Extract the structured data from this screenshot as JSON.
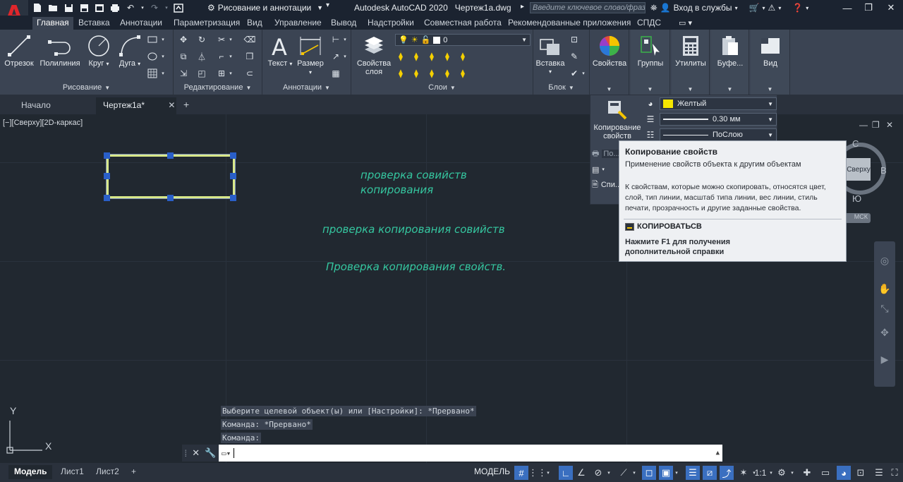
{
  "titlebar": {
    "logo": "A",
    "workspace": "Рисование и аннотации",
    "app_title": "Autodesk AutoCAD 2020",
    "file_name": "Чертеж1a.dwg",
    "search_placeholder": "Введите ключевое слово/фразу",
    "signin": "Вход в службы",
    "icons": [
      "new-icon",
      "open-icon",
      "save-icon",
      "saveas-icon",
      "web-icon",
      "print-icon",
      "undo-icon",
      "redo-icon",
      "share-icon",
      "gear-icon",
      "search-icon",
      "binoculars-icon",
      "user-icon",
      "cart-icon",
      "triangle-icon",
      "help-icon",
      "minimize-icon",
      "restore-icon",
      "close-icon"
    ]
  },
  "ribbon_tabs": [
    "Главная",
    "Вставка",
    "Аннотации",
    "Параметризация",
    "Вид",
    "Управление",
    "Вывод",
    "Надстройки",
    "Совместная работа",
    "Рекомендованные приложения",
    "СПДС"
  ],
  "ribbon": {
    "draw": {
      "title": "Рисование",
      "line": "Отрезок",
      "polyline": "Полилиния",
      "circle": "Круг",
      "arc": "Дуга"
    },
    "modify": {
      "title": "Редактирование"
    },
    "annotation": {
      "title": "Аннотации",
      "text": "Текст",
      "dimension": "Размер"
    },
    "layers": {
      "title": "Слои",
      "layer_props_1": "Свойства",
      "layer_props_2": "слоя",
      "current_layer": "0"
    },
    "block": {
      "title": "Блок",
      "insert": "Вставка"
    },
    "properties": {
      "label": "Свойства"
    },
    "groups": {
      "label": "Группы"
    },
    "utilities": {
      "label": "Утилиты"
    },
    "clipboard": {
      "label": "Буфе..."
    },
    "view": {
      "label": "Вид"
    }
  },
  "doc_tabs": {
    "start": "Начало",
    "drawing": "Чертеж1a*"
  },
  "viewport_label": "[−][Сверху][2D-каркас]",
  "canvas_texts": [
    "проверка совийств",
    "копирования",
    "проверка копирования совийств",
    "Проверка копирования свойств."
  ],
  "viewcube": {
    "n": "С",
    "e": "В",
    "s": "Ю",
    "face": "Сверху",
    "wcs": "МСК"
  },
  "ucs": {
    "x": "X",
    "y": "Y"
  },
  "command_history": [
    "Выберите целевой объект(ы) или [Настройки]: *Прервано*",
    "Команда: *Прервано*",
    "Команда:"
  ],
  "prop_flyout": {
    "copy_props_1": "Копирование",
    "copy_props_2": "свойств",
    "color": "Желтый",
    "color_hex": "#f5e600",
    "lineweight": "0.30 мм",
    "linetype": "ПоСлою",
    "partial_1": "По...",
    "partial_2": "Спи..."
  },
  "tooltip": {
    "title": "Копирование свойств",
    "desc": "Применение свойств объекта к другим объектам",
    "body": "К свойствам, которые можно скопировать, относятся цвет, слой, тип линии, масштаб типа линии, вес линии, стиль печати, прозрачность и другие заданные свойства.",
    "command": "КОПИРОВАТЬСВ",
    "help": "Нажмите F1 для получения дополнительной справки"
  },
  "statusbar": {
    "tabs": [
      "Модель",
      "Лист1",
      "Лист2"
    ],
    "model": "МОДЕЛЬ",
    "scale": "1:1"
  },
  "colors": {
    "accent": "#3a6fc0",
    "text_green": "#35c7a0",
    "selection": "#d8e88a",
    "grip": "#2a5fc8"
  }
}
